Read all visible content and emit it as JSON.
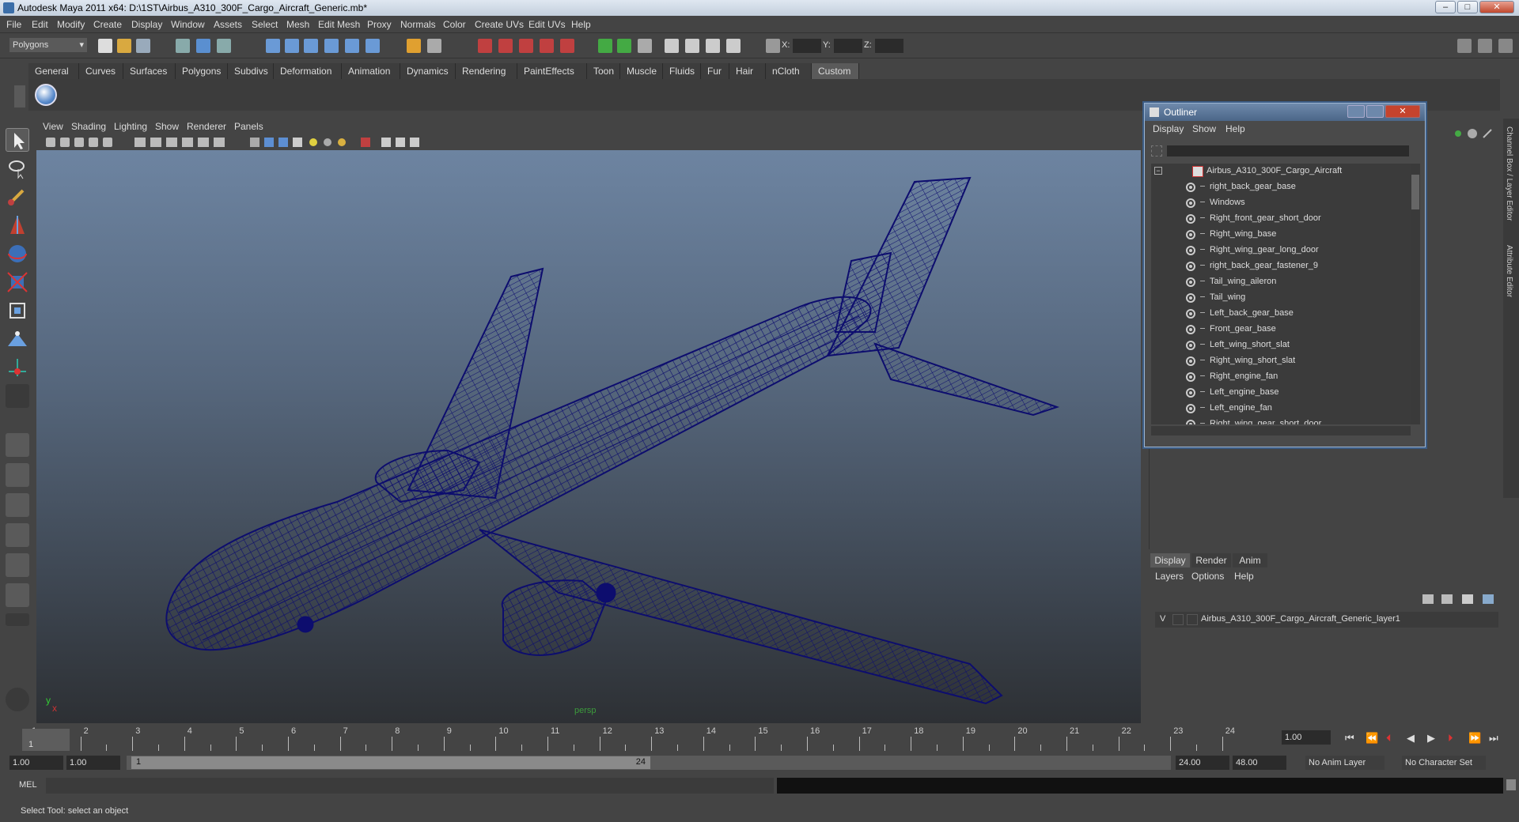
{
  "window": {
    "title": "Autodesk Maya 2011 x64: D:\\1ST\\Airbus_A310_300F_Cargo_Aircraft_Generic.mb*",
    "min": "–",
    "max": "□",
    "close": "✕"
  },
  "menubar": [
    "File",
    "Edit",
    "Modify",
    "Create",
    "Display",
    "Window",
    "Assets",
    "Select",
    "Mesh",
    "Edit Mesh",
    "Proxy",
    "Normals",
    "Color",
    "Create UVs",
    "Edit UVs",
    "Help"
  ],
  "statusline": {
    "mode": "Polygons",
    "x_label": "X:",
    "y_label": "Y:",
    "z_label": "Z:"
  },
  "shelf_tabs": [
    "General",
    "Curves",
    "Surfaces",
    "Polygons",
    "Subdivs",
    "Deformation",
    "Animation",
    "Dynamics",
    "Rendering",
    "PaintEffects",
    "Toon",
    "Muscle",
    "Fluids",
    "Fur",
    "Hair",
    "nCloth",
    "Custom"
  ],
  "shelf_active": "Custom",
  "viewport": {
    "menu": [
      "View",
      "Shading",
      "Lighting",
      "Show",
      "Renderer",
      "Panels"
    ],
    "camera": "persp",
    "axis_x": "x",
    "axis_y": "y"
  },
  "outliner": {
    "title": "Outliner",
    "menu": [
      "Display",
      "Show",
      "Help"
    ],
    "root": "Airbus_A310_300F_Cargo_Aircraft",
    "items": [
      "right_back_gear_base",
      "Windows",
      "Right_front_gear_short_door",
      "Right_wing_base",
      "Right_wing_gear_long_door",
      "right_back_gear_fastener_9",
      "Tail_wing_aileron",
      "Tail_wing",
      "Left_back_gear_base",
      "Front_gear_base",
      "Left_wing_short_slat",
      "Right_wing_short_slat",
      "Right_engine_fan",
      "Left_engine_base",
      "Left_engine_fan"
    ],
    "partial_item": "Right_wing_gear_short_door"
  },
  "side_tabs": [
    "Channel Box / Layer Editor",
    "Attribute Editor"
  ],
  "layer_editor": {
    "tabs": [
      "Display",
      "Render",
      "Anim"
    ],
    "menu": [
      "Layers",
      "Options",
      "Help"
    ],
    "layer_visible": "V",
    "layer_name": "Airbus_A310_300F_Cargo_Aircraft_Generic_layer1"
  },
  "timeline": {
    "ticks": [
      "1",
      "2",
      "3",
      "4",
      "5",
      "6",
      "7",
      "8",
      "9",
      "10",
      "11",
      "12",
      "13",
      "14",
      "15",
      "16",
      "17",
      "18",
      "19",
      "20",
      "21",
      "22",
      "23",
      "24"
    ],
    "current_frame": "1.00",
    "current_marker": "1"
  },
  "range": {
    "start": "1.00",
    "start2": "1.00",
    "range_start": "1",
    "range_end": "24",
    "end": "24.00",
    "end2": "48.00",
    "anim_layer": "No Anim Layer",
    "character_set": "No Character Set"
  },
  "cmdline": {
    "label": "MEL"
  },
  "helpline": {
    "text": "Select Tool: select an object"
  },
  "colors": {
    "wire": "#0d0d6e",
    "accent": "#3c5d86"
  }
}
